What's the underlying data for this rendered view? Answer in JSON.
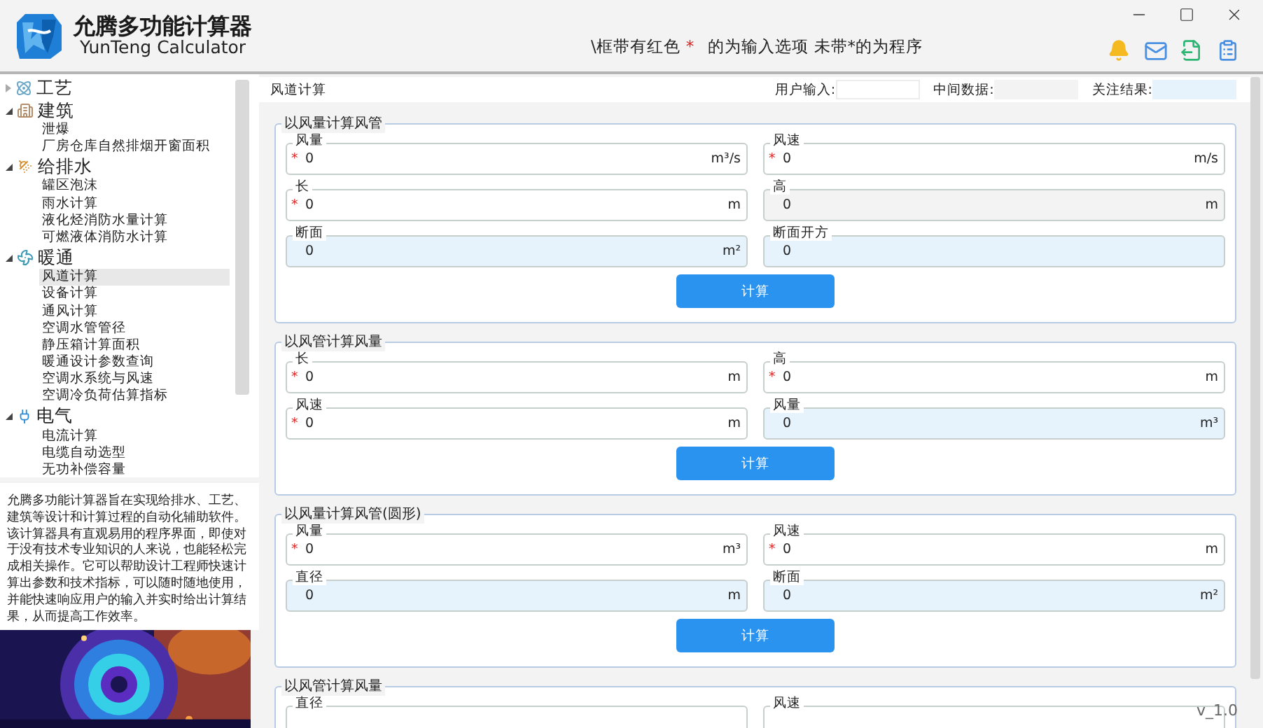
{
  "app": {
    "title": "允腾多功能计算器",
    "subtitle": "YunTeng Calculator"
  },
  "hint": {
    "before": "\\框带有红色",
    "mark": "*",
    "after": "的为输入选项 未带*的为程序"
  },
  "sidebar": {
    "tree": [
      {
        "label": "工艺",
        "expanded": false
      },
      {
        "label": "建筑",
        "expanded": true,
        "children": [
          {
            "label": "泄爆",
            "selected": false
          },
          {
            "label": "厂房仓库自然排烟开窗面积",
            "selected": false
          }
        ]
      },
      {
        "label": "给排水",
        "expanded": true,
        "children": [
          {
            "label": "罐区泡沫",
            "selected": false
          },
          {
            "label": "雨水计算",
            "selected": false
          },
          {
            "label": "液化烃消防水量计算",
            "selected": false
          },
          {
            "label": "可燃液体消防水计算",
            "selected": false
          }
        ]
      },
      {
        "label": "暖通",
        "expanded": true,
        "children": [
          {
            "label": "风道计算",
            "selected": true
          },
          {
            "label": "设备计算",
            "selected": false
          },
          {
            "label": "通风计算",
            "selected": false
          },
          {
            "label": "空调水管管径",
            "selected": false
          },
          {
            "label": "静压箱计算面积",
            "selected": false
          },
          {
            "label": "暖通设计参数查询",
            "selected": false
          },
          {
            "label": "空调水系统与风速",
            "selected": false
          },
          {
            "label": "空调冷负荷估算指标",
            "selected": false
          }
        ]
      },
      {
        "label": "电气",
        "expanded": true,
        "children": [
          {
            "label": "电流计算",
            "selected": false
          },
          {
            "label": "电缆自动选型",
            "selected": false
          },
          {
            "label": "无功补偿容量",
            "selected": false
          }
        ]
      }
    ]
  },
  "description": "允腾多功能计算器旨在实现给排水、工艺、建筑等设计和计算过程的自动化辅助软件。该计算器具有直观易用的程序界面，即使对于没有技术专业知识的人来说，也能轻松完成相关操作。它可以帮助设计工程师快速计算出参数和技术指标，可以随时随地使用，并能快速响应用户的输入并实时给出计算结果，从而提高工作效率。",
  "page": {
    "title": "风道计算",
    "legend": [
      {
        "label": "用户输入:",
        "kind": "input"
      },
      {
        "label": "中间数据:",
        "kind": "intermediate"
      },
      {
        "label": "关注结果:",
        "kind": "result"
      }
    ]
  },
  "panels": [
    {
      "title": "以风量计算风管",
      "button": "计算",
      "fields": [
        {
          "label": "风量",
          "kind": "input",
          "value": "0",
          "unit": "m³/s"
        },
        {
          "label": "风速",
          "kind": "input",
          "value": "0",
          "unit": "m/s"
        },
        {
          "label": "长",
          "kind": "input",
          "value": "0",
          "unit": "m"
        },
        {
          "label": "高",
          "kind": "intermediate",
          "value": "0",
          "unit": "m"
        },
        {
          "label": "断面",
          "kind": "result",
          "value": "0",
          "unit": "m²"
        },
        {
          "label": "断面开方",
          "kind": "result",
          "value": "0"
        }
      ]
    },
    {
      "title": "以风管计算风量",
      "button": "计算",
      "fields": [
        {
          "label": "长",
          "kind": "input",
          "value": "0",
          "unit": "m"
        },
        {
          "label": "高",
          "kind": "input",
          "value": "0",
          "unit": "m"
        },
        {
          "label": "风速",
          "kind": "input",
          "value": "0",
          "unit": "m"
        },
        {
          "label": "风量",
          "kind": "result",
          "value": "0",
          "unit": "m³"
        }
      ]
    },
    {
      "title": "以风量计算风管(圆形)",
      "button": "计算",
      "fields": [
        {
          "label": "风量",
          "kind": "input",
          "value": "0",
          "unit": "m³"
        },
        {
          "label": "风速",
          "kind": "input",
          "value": "0",
          "unit": "m"
        },
        {
          "label": "直径",
          "kind": "result",
          "value": "0",
          "unit": "m"
        },
        {
          "label": "断面",
          "kind": "result",
          "value": "0",
          "unit": "m²"
        }
      ]
    },
    {
      "title": "以风管计算风量",
      "fields": [
        {
          "label": "直径"
        },
        {
          "label": "风速"
        }
      ]
    }
  ],
  "version": "v_1.0"
}
